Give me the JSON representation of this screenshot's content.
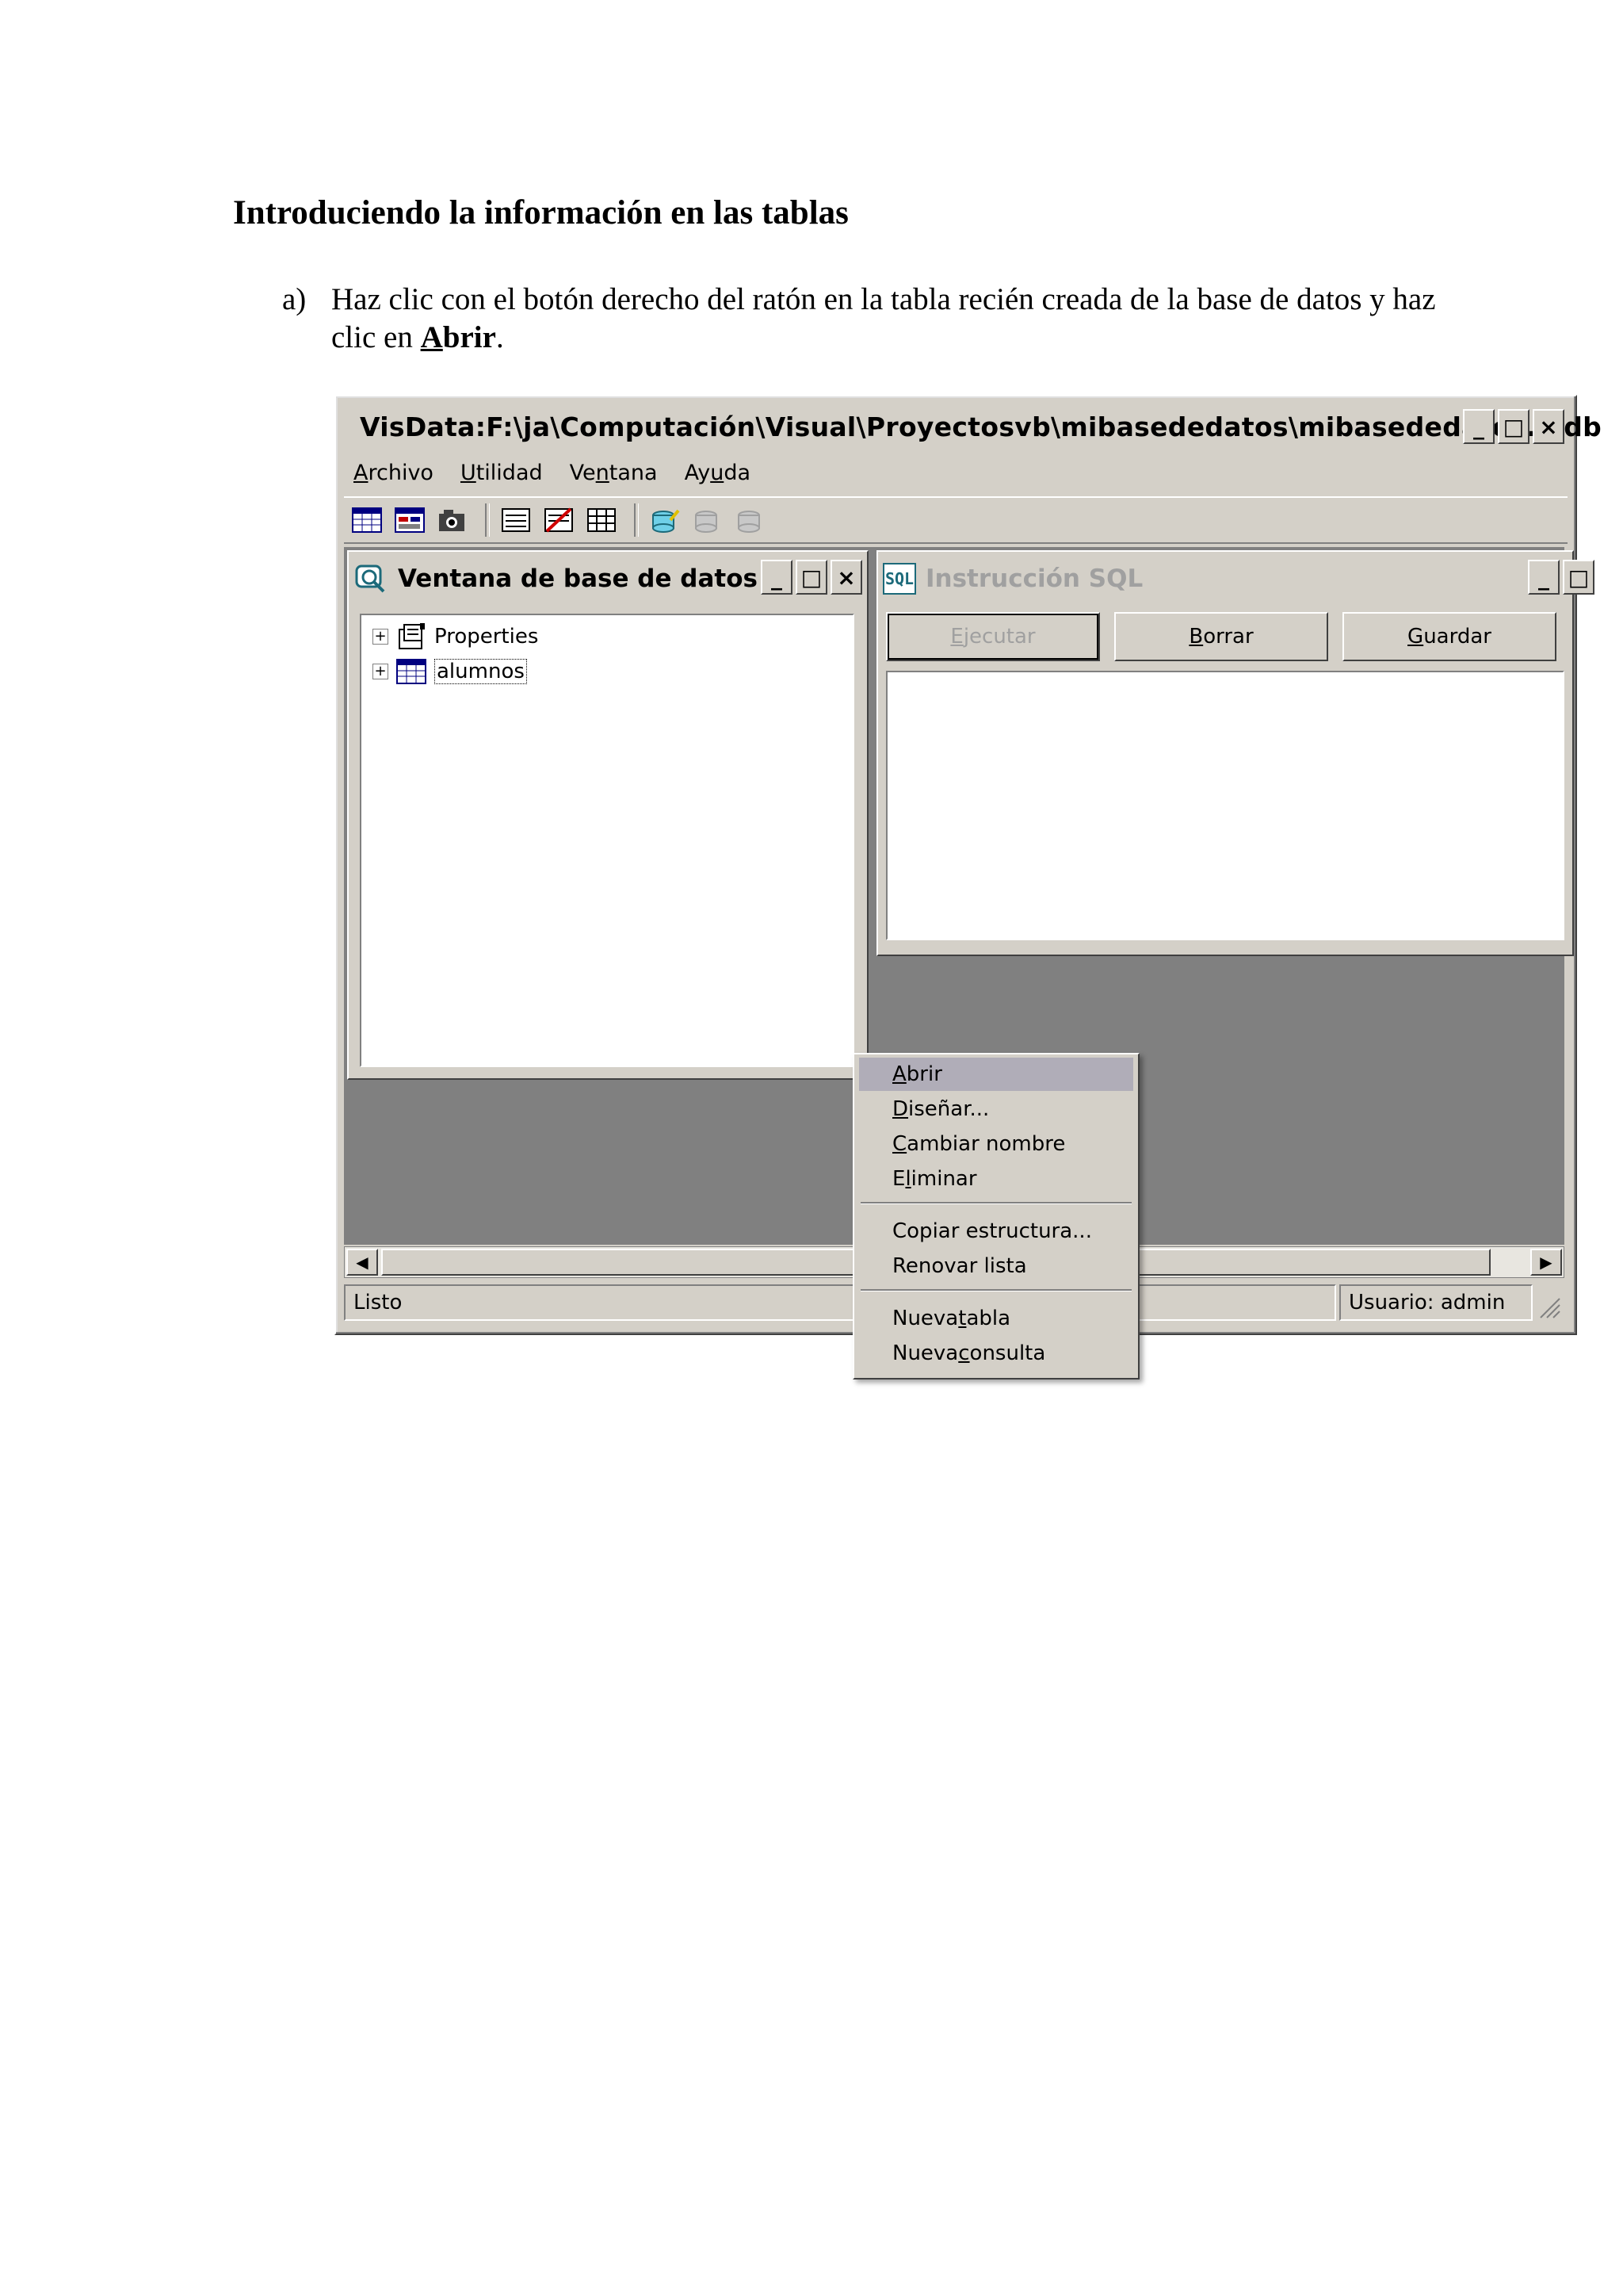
{
  "document": {
    "heading": "Introduciendo la información en las tablas",
    "step_marker": "a)",
    "step_text_before": "Haz clic con el botón derecho del ratón en la tabla recién creada de la base de datos y haz clic en ",
    "step_emphasis_underlined": "A",
    "step_emphasis_rest": "brir",
    "step_text_after": "."
  },
  "window": {
    "title": "VisData:F:\\ja\\Computación\\Visual\\Proyectosvb\\mibasededatos\\mibasededatos.mdb",
    "caption_buttons": {
      "minimize": "_",
      "maximize": "□",
      "close": "×"
    },
    "menu": [
      {
        "mnemonic": "A",
        "rest": "rchivo"
      },
      {
        "mnemonic": "U",
        "rest": "tilidad"
      },
      {
        "pre": "Ve",
        "mnemonic": "n",
        "rest": "tana"
      },
      {
        "pre": "Ay",
        "mnemonic": "u",
        "rest": "da"
      }
    ]
  },
  "db_window": {
    "title": "Ventana de base de datos",
    "tree": [
      {
        "expander": "+",
        "label": "Properties",
        "icon": "properties-icon"
      },
      {
        "expander": "+",
        "label": "alumnos",
        "icon": "table-icon",
        "selected": true
      }
    ]
  },
  "sql_window": {
    "icon": "SQL",
    "title": "Instrucción SQL",
    "buttons": [
      {
        "mnemonic": "E",
        "rest": "jecutar",
        "disabled": true
      },
      {
        "mnemonic": "B",
        "rest": "orrar"
      },
      {
        "mnemonic": "G",
        "rest": "uardar"
      }
    ]
  },
  "context_menu": {
    "items": [
      {
        "pre": "",
        "mnemonic": "A",
        "rest": "brir",
        "highlighted": true
      },
      {
        "pre": "",
        "mnemonic": "D",
        "rest": "iseñar..."
      },
      {
        "pre": "",
        "mnemonic": "C",
        "rest": "ambiar nombre"
      },
      {
        "pre": "E",
        "mnemonic": "l",
        "rest": "iminar"
      },
      {
        "pre": "Copiar estructura...",
        "mnemonic": "",
        "rest": ""
      },
      {
        "pre": "Renovar lista",
        "mnemonic": "",
        "rest": ""
      },
      {
        "pre": "Nueva ",
        "mnemonic": "t",
        "rest": "abla"
      },
      {
        "pre": "Nueva ",
        "mnemonic": "c",
        "rest": "onsulta"
      }
    ]
  },
  "status": {
    "left": "Listo",
    "user": "Usuario: admin"
  },
  "colors": {
    "face": "#d4d0c8",
    "mdi_background": "#808080",
    "highlight": "#b0adb8"
  }
}
